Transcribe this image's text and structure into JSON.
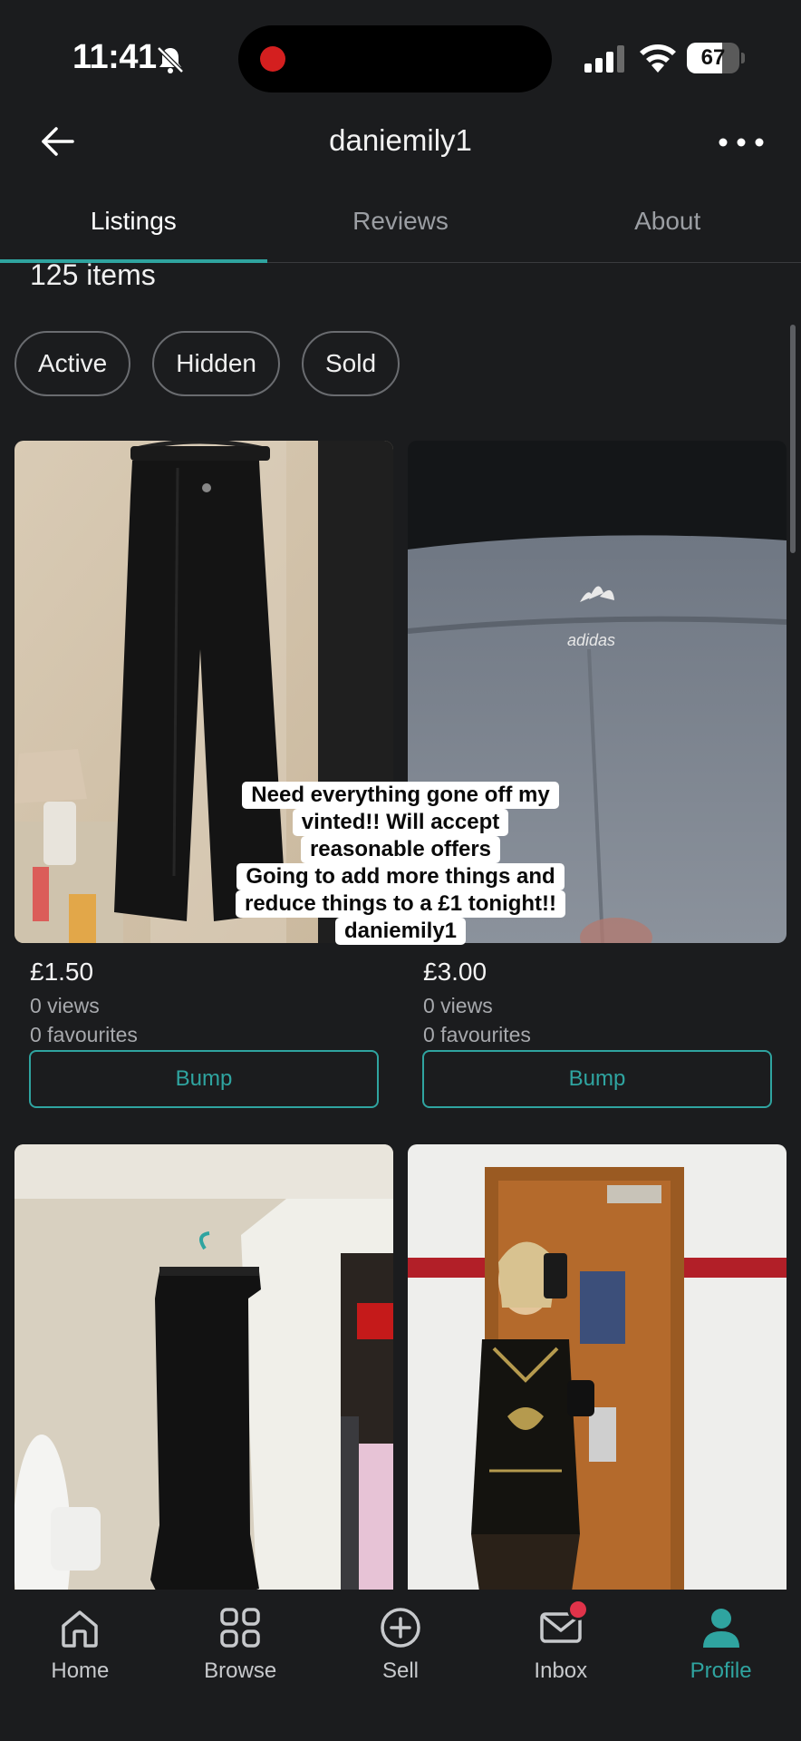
{
  "status_bar": {
    "time": "11:41",
    "battery": "67",
    "battery_level": 0.67
  },
  "header": {
    "title": "daniemily1"
  },
  "tabs": [
    {
      "label": "Listings",
      "active": true
    },
    {
      "label": "Reviews",
      "active": false
    },
    {
      "label": "About",
      "active": false
    }
  ],
  "item_count": "125 items",
  "filters": [
    "Active",
    "Hidden",
    "Sold"
  ],
  "products": [
    {
      "price": "£1.50",
      "views": "0 views",
      "favourites": "0 favourites",
      "bump_label": "Bump"
    },
    {
      "price": "£3.00",
      "views": "0 views",
      "favourites": "0 favourites",
      "bump_label": "Bump"
    }
  ],
  "caption": {
    "lines": [
      "Need everything gone off my",
      "vinted!! Will accept",
      "reasonable offers",
      "Going to add more things and",
      "reduce things to a £1 tonight!!",
      "daniemily1"
    ]
  },
  "bottom_nav": [
    {
      "label": "Home",
      "icon": "home-icon"
    },
    {
      "label": "Browse",
      "icon": "grid-icon"
    },
    {
      "label": "Sell",
      "icon": "plus-circle-icon"
    },
    {
      "label": "Inbox",
      "icon": "mail-icon"
    },
    {
      "label": "Profile",
      "icon": "person-icon",
      "active": true
    }
  ],
  "colors": {
    "accent": "#2fa4a0",
    "background": "#1b1c1e",
    "notification": "#e0334a"
  }
}
